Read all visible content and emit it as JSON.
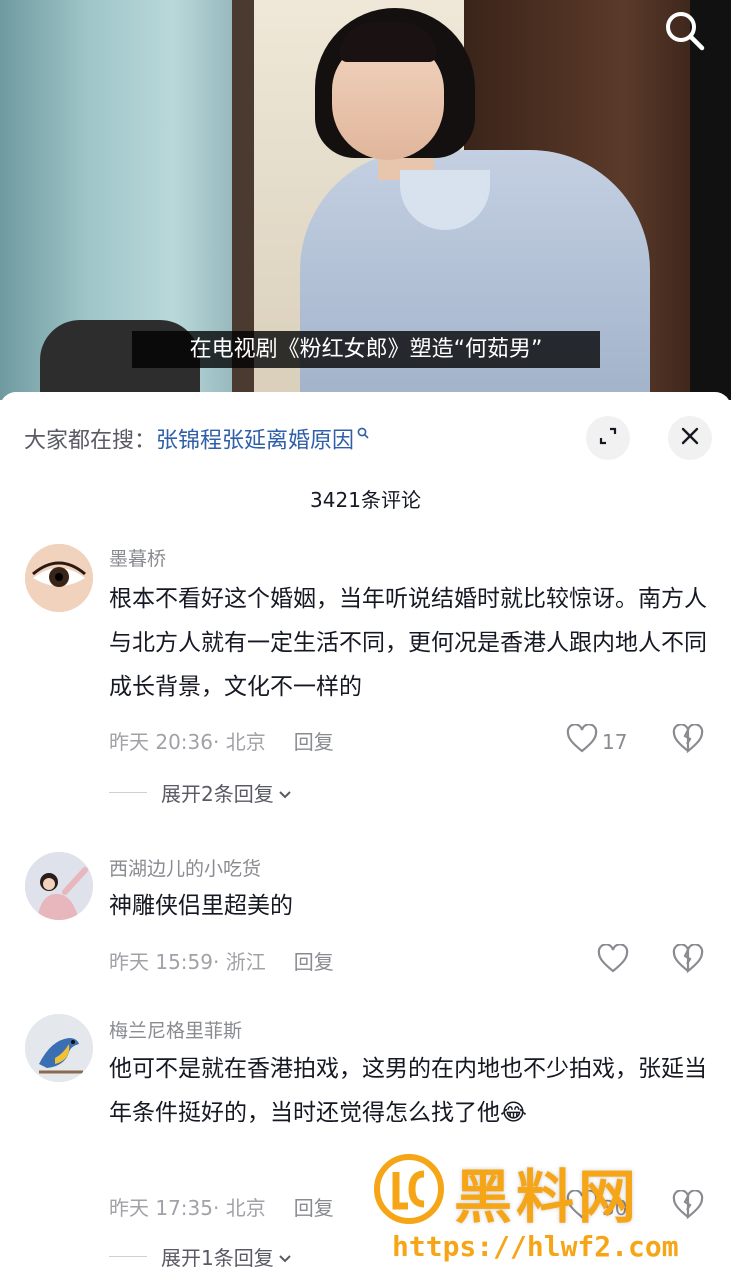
{
  "video": {
    "subtitle": "在电视剧《粉红女郎》塑造“何茹男”",
    "search_icon": "search-icon"
  },
  "sheet": {
    "hot_prefix": "大家都在搜：",
    "hot_term": "张锦程张延离婚原因",
    "expand_icon": "expand-icon",
    "close_icon": "close-icon",
    "comment_count": "3421条评论"
  },
  "comments": [
    {
      "username": "墨暮桥",
      "body": "根本不看好这个婚姻，当年听说结婚时就比较惊讶。南方人与北方人就有一定生活不同，更何况是香港人跟内地人不同成长背景，文化不一样的",
      "time_location": "昨天 20:36· 北京",
      "reply": "回复",
      "likes": "17",
      "more_replies": "展开2条回复"
    },
    {
      "username": "西湖边儿的小吃货",
      "body": "神雕侠侣里超美的",
      "time_location": "昨天 15:59· 浙江",
      "reply": "回复",
      "likes": "",
      "more_replies": ""
    },
    {
      "username": "梅兰尼格里菲斯",
      "body": "他可不是就在香港拍戏，这男的在内地也不少拍戏，张延当年条件挺好的，当时还觉得怎么找了他",
      "emoji": "😂",
      "time_location": "昨天 17:35· 北京",
      "reply": "回复",
      "likes": "30",
      "more_replies": "展开1条回复"
    }
  ],
  "watermark": {
    "title": "黑料网",
    "url": "https://hlwf2.com"
  }
}
